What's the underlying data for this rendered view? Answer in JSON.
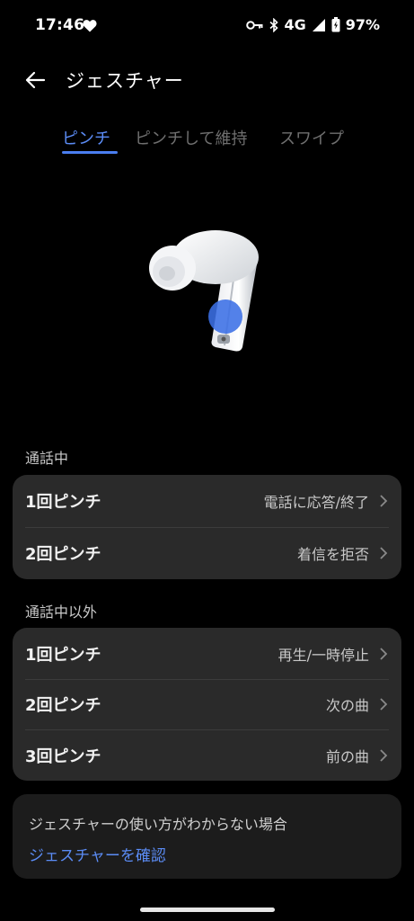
{
  "status_bar": {
    "time": "17:46",
    "network": "4G",
    "battery": "97%",
    "icons": [
      "heart-icon",
      "key-icon",
      "bluetooth-icon",
      "signal-icon",
      "battery-icon"
    ]
  },
  "app_bar": {
    "title": "ジェスチャー"
  },
  "tabs": [
    {
      "label": "ピンチ",
      "active": true
    },
    {
      "label": "ピンチして維持",
      "active": false
    },
    {
      "label": "スワイプ",
      "active": false
    }
  ],
  "sections": [
    {
      "header": "通話中",
      "rows": [
        {
          "label": "1回ピンチ",
          "value": "電話に応答/終了"
        },
        {
          "label": "2回ピンチ",
          "value": "着信を拒否"
        }
      ]
    },
    {
      "header": "通話中以外",
      "rows": [
        {
          "label": "1回ピンチ",
          "value": "再生/一時停止"
        },
        {
          "label": "2回ピンチ",
          "value": "次の曲"
        },
        {
          "label": "3回ピンチ",
          "value": "前の曲"
        }
      ]
    }
  ],
  "help": {
    "text": "ジェスチャーの使い方がわからない場合",
    "link": "ジェスチャーを確認"
  },
  "colors": {
    "accent": "#5b8cf5",
    "card": "#2a2a2a",
    "background": "#000000"
  }
}
